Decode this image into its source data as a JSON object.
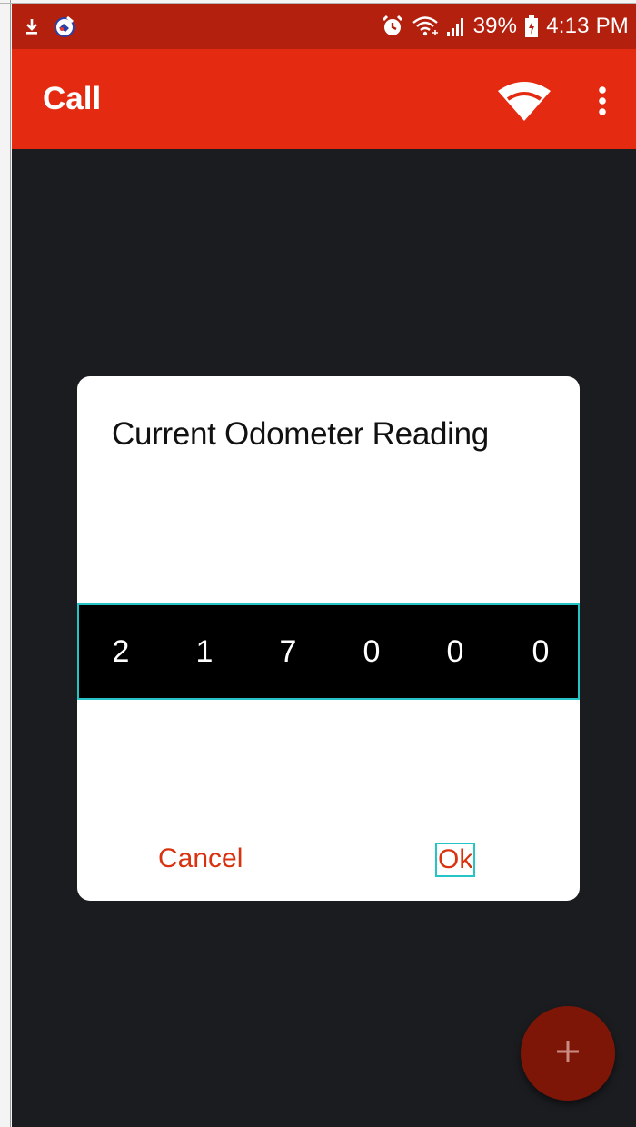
{
  "status_bar": {
    "battery": "39%",
    "time": "4:13 PM",
    "icons": [
      "download-icon",
      "notification-app-icon",
      "alarm-icon",
      "wifi-signal-icon",
      "cell-signal-icon",
      "battery-charging-icon"
    ]
  },
  "app_bar": {
    "title": "Call",
    "actions": [
      "wifi-icon",
      "more-vert-icon"
    ]
  },
  "dialog": {
    "title": "Current Odometer Reading",
    "digits": [
      "2",
      "1",
      "7",
      "0",
      "0",
      "0"
    ],
    "cancel_label": "Cancel",
    "ok_label": "Ok"
  },
  "fab": {
    "icon": "plus-icon"
  },
  "colors": {
    "status_bar": "#b3200e",
    "app_bar": "#e42a10",
    "background": "#1b1c20",
    "accent": "#d8320f",
    "focus_outline": "#25c4c6",
    "fab": "#7e1608"
  }
}
